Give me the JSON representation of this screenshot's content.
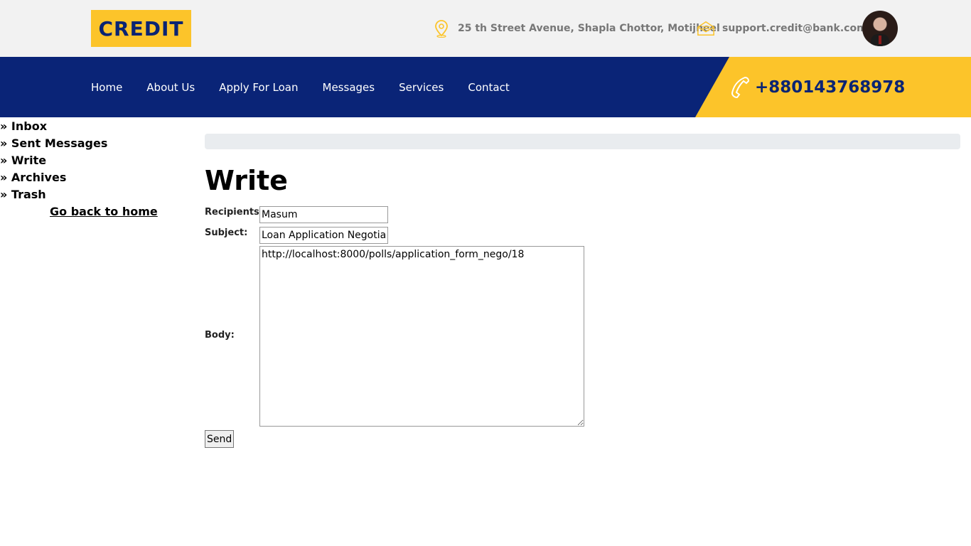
{
  "header": {
    "logo": "CREDIT",
    "address": "25 th Street Avenue, Shapla Chottor, Motijheel",
    "email": "support.credit@bank.com",
    "address_icon": "location-pin-icon",
    "email_icon": "envelope-icon"
  },
  "nav": {
    "items": [
      "Home",
      "About Us",
      "Apply For Loan",
      "Messages",
      "Services",
      "Contact"
    ],
    "phone": "+880143768978",
    "phone_icon": "phone-icon"
  },
  "sidebar": {
    "items": [
      "» Inbox",
      "» Sent Messages",
      "» Write",
      "» Archives",
      "» Trash"
    ],
    "home_link": "Go back to home"
  },
  "main": {
    "title": "Write",
    "form": {
      "recipients_label": "Recipients:",
      "recipients_value": "Masum",
      "subject_label": "Subject:",
      "subject_value": "Loan Application Negotiation",
      "body_label": "Body:",
      "body_value": "http://localhost:8000/polls/application_form_nego/18",
      "send_label": "Send"
    }
  },
  "colors": {
    "brand_yellow": "#fcc42a",
    "brand_navy": "#0a2477"
  }
}
